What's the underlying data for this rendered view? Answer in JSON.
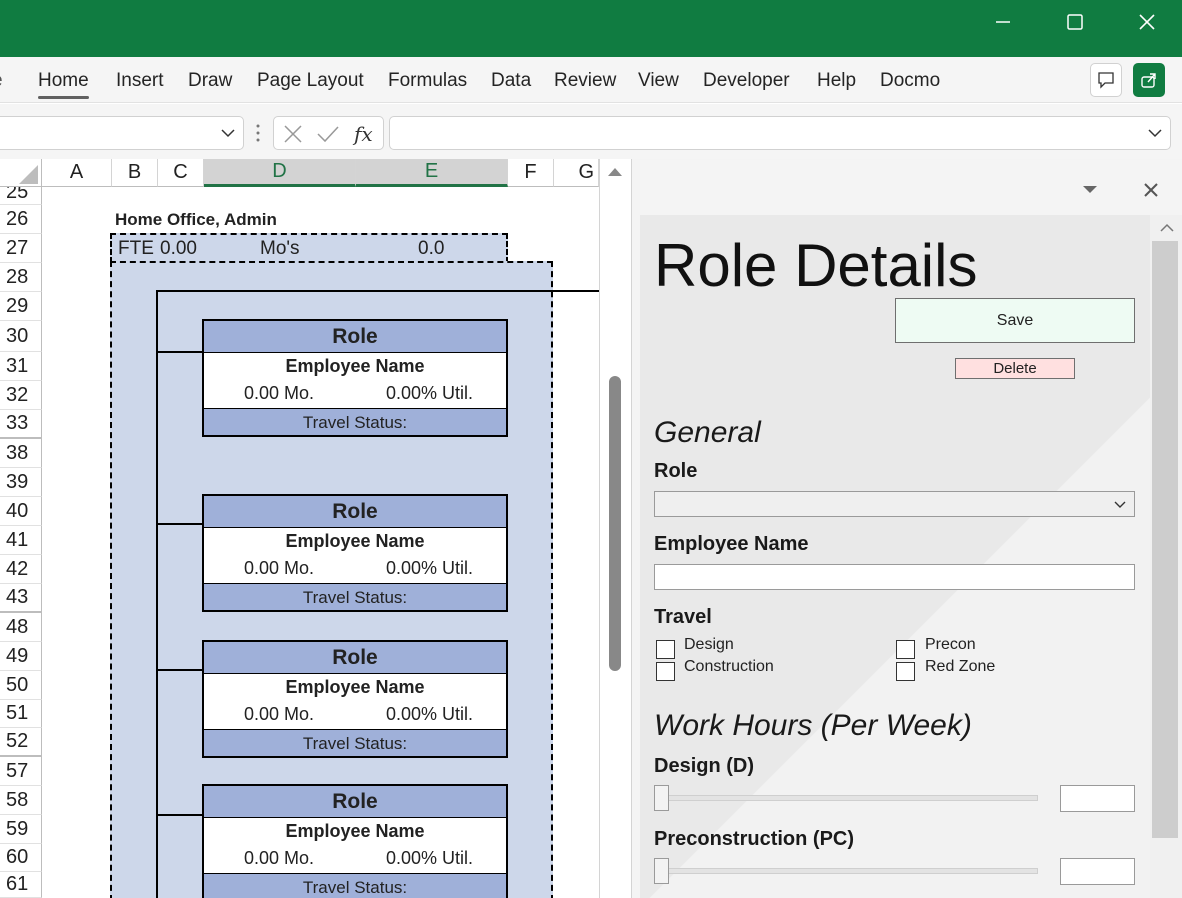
{
  "ribbon": {
    "tabs": [
      "Home",
      "Insert",
      "Draw",
      "Page Layout",
      "Formulas",
      "Data",
      "Review",
      "View",
      "Developer",
      "Help",
      "Docmo"
    ],
    "active": "Home"
  },
  "formula_bar": {
    "name_box": "",
    "formula": ""
  },
  "columns": [
    "A",
    "B",
    "C",
    "D",
    "E",
    "F",
    "G"
  ],
  "rows": [
    "25",
    "26",
    "27",
    "28",
    "29",
    "30",
    "31",
    "32",
    "33",
    "38",
    "39",
    "40",
    "41",
    "42",
    "43",
    "48",
    "49",
    "50",
    "51",
    "52",
    "57",
    "58",
    "59",
    "60",
    "61"
  ],
  "sheet": {
    "heading": "Home Office, Admin",
    "fte_label": "FTE",
    "fte_value": "0.00",
    "mos_label": "Mo's",
    "mos_value": "0.0",
    "cards": [
      {
        "role": "Role",
        "employee": "Employee Name",
        "months": "0.00 Mo.",
        "util": "0.00% Util.",
        "travel": "Travel Status:"
      },
      {
        "role": "Role",
        "employee": "Employee Name",
        "months": "0.00 Mo.",
        "util": "0.00% Util.",
        "travel": "Travel Status:"
      },
      {
        "role": "Role",
        "employee": "Employee Name",
        "months": "0.00 Mo.",
        "util": "0.00% Util.",
        "travel": "Travel Status:"
      },
      {
        "role": "Role",
        "employee": "Employee Name",
        "months": "0.00 Mo.",
        "util": "0.00% Util.",
        "travel": "Travel Status:"
      }
    ]
  },
  "pane": {
    "title": "Role Details",
    "save_label": "Save",
    "delete_label": "Delete",
    "general_heading": "General",
    "role_label": "Role",
    "role_value": "",
    "employee_label": "Employee Name",
    "employee_value": "",
    "travel_label": "Travel",
    "travel_options": [
      "Design",
      "Precon",
      "Construction",
      "Red Zone"
    ],
    "work_hours_heading": "Work Hours (Per Week)",
    "design_label": "Design (D)",
    "design_value": "",
    "precon_label": "Preconstruction (PC)",
    "precon_value": ""
  },
  "colors": {
    "title_bar": "#107c41",
    "card_header": "#9fb0d9",
    "card_group_bg": "#cdd7ea",
    "save_bg": "#eefbf3",
    "delete_bg": "#ffe0e0"
  }
}
